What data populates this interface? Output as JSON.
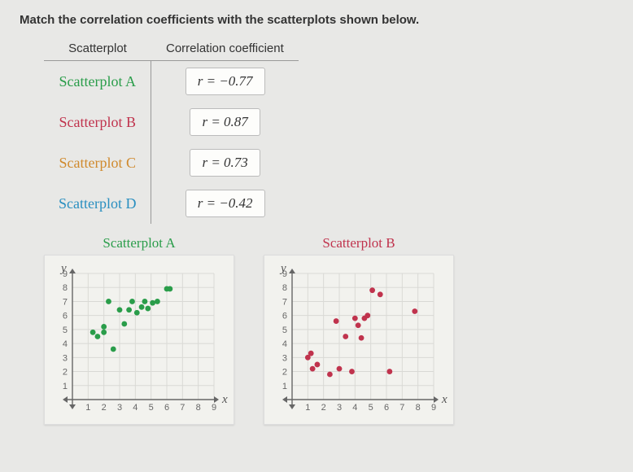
{
  "question": "Match the correlation coefficients with the scatterplots shown below.",
  "table": {
    "header_left": "Scatterplot",
    "header_right": "Correlation coefficient",
    "rows": [
      {
        "label": "Scatterplot A",
        "coeff": "r = −0.77"
      },
      {
        "label": "Scatterplot B",
        "coeff": "r = 0.87"
      },
      {
        "label": "Scatterplot C",
        "coeff": "r = 0.73"
      },
      {
        "label": "Scatterplot D",
        "coeff": "r = −0.42"
      }
    ]
  },
  "plotA": {
    "title": "Scatterplot A",
    "xlabel": "x",
    "ylabel": "y"
  },
  "plotB": {
    "title": "Scatterplot B",
    "xlabel": "x",
    "ylabel": "y"
  },
  "chart_data": [
    {
      "type": "scatter",
      "name": "Scatterplot A",
      "title": "Scatterplot A",
      "xlabel": "x",
      "ylabel": "y",
      "xlim": [
        0,
        9
      ],
      "ylim": [
        0,
        9
      ],
      "xticks": [
        1,
        2,
        3,
        4,
        5,
        6,
        7,
        8,
        9
      ],
      "yticks": [
        1,
        2,
        3,
        4,
        5,
        6,
        7,
        8,
        9
      ],
      "color": "#2a9d4a",
      "points": [
        [
          1.3,
          4.8
        ],
        [
          1.6,
          4.5
        ],
        [
          2.0,
          4.8
        ],
        [
          2.0,
          5.2
        ],
        [
          2.3,
          7.0
        ],
        [
          2.6,
          3.6
        ],
        [
          3.0,
          6.4
        ],
        [
          3.3,
          5.4
        ],
        [
          3.6,
          6.4
        ],
        [
          3.8,
          7.0
        ],
        [
          4.1,
          6.2
        ],
        [
          4.4,
          6.6
        ],
        [
          4.6,
          7.0
        ],
        [
          4.8,
          6.5
        ],
        [
          5.1,
          6.9
        ],
        [
          5.4,
          7.0
        ],
        [
          6.0,
          7.9
        ],
        [
          6.2,
          7.9
        ]
      ]
    },
    {
      "type": "scatter",
      "name": "Scatterplot B",
      "title": "Scatterplot B",
      "xlabel": "x",
      "ylabel": "y",
      "xlim": [
        0,
        9
      ],
      "ylim": [
        0,
        9
      ],
      "xticks": [
        1,
        2,
        3,
        4,
        5,
        6,
        7,
        8,
        9
      ],
      "yticks": [
        1,
        2,
        3,
        4,
        5,
        6,
        7,
        8,
        9
      ],
      "color": "#c0334d",
      "points": [
        [
          1.0,
          3.0
        ],
        [
          1.2,
          3.3
        ],
        [
          1.3,
          2.2
        ],
        [
          1.6,
          2.5
        ],
        [
          2.4,
          1.8
        ],
        [
          2.8,
          5.6
        ],
        [
          3.0,
          2.2
        ],
        [
          3.4,
          4.5
        ],
        [
          3.8,
          2.0
        ],
        [
          4.0,
          5.8
        ],
        [
          4.2,
          5.3
        ],
        [
          4.4,
          4.4
        ],
        [
          4.6,
          5.8
        ],
        [
          4.8,
          6.0
        ],
        [
          5.1,
          7.8
        ],
        [
          5.6,
          7.5
        ],
        [
          6.2,
          2.0
        ],
        [
          7.8,
          6.3
        ]
      ]
    }
  ]
}
